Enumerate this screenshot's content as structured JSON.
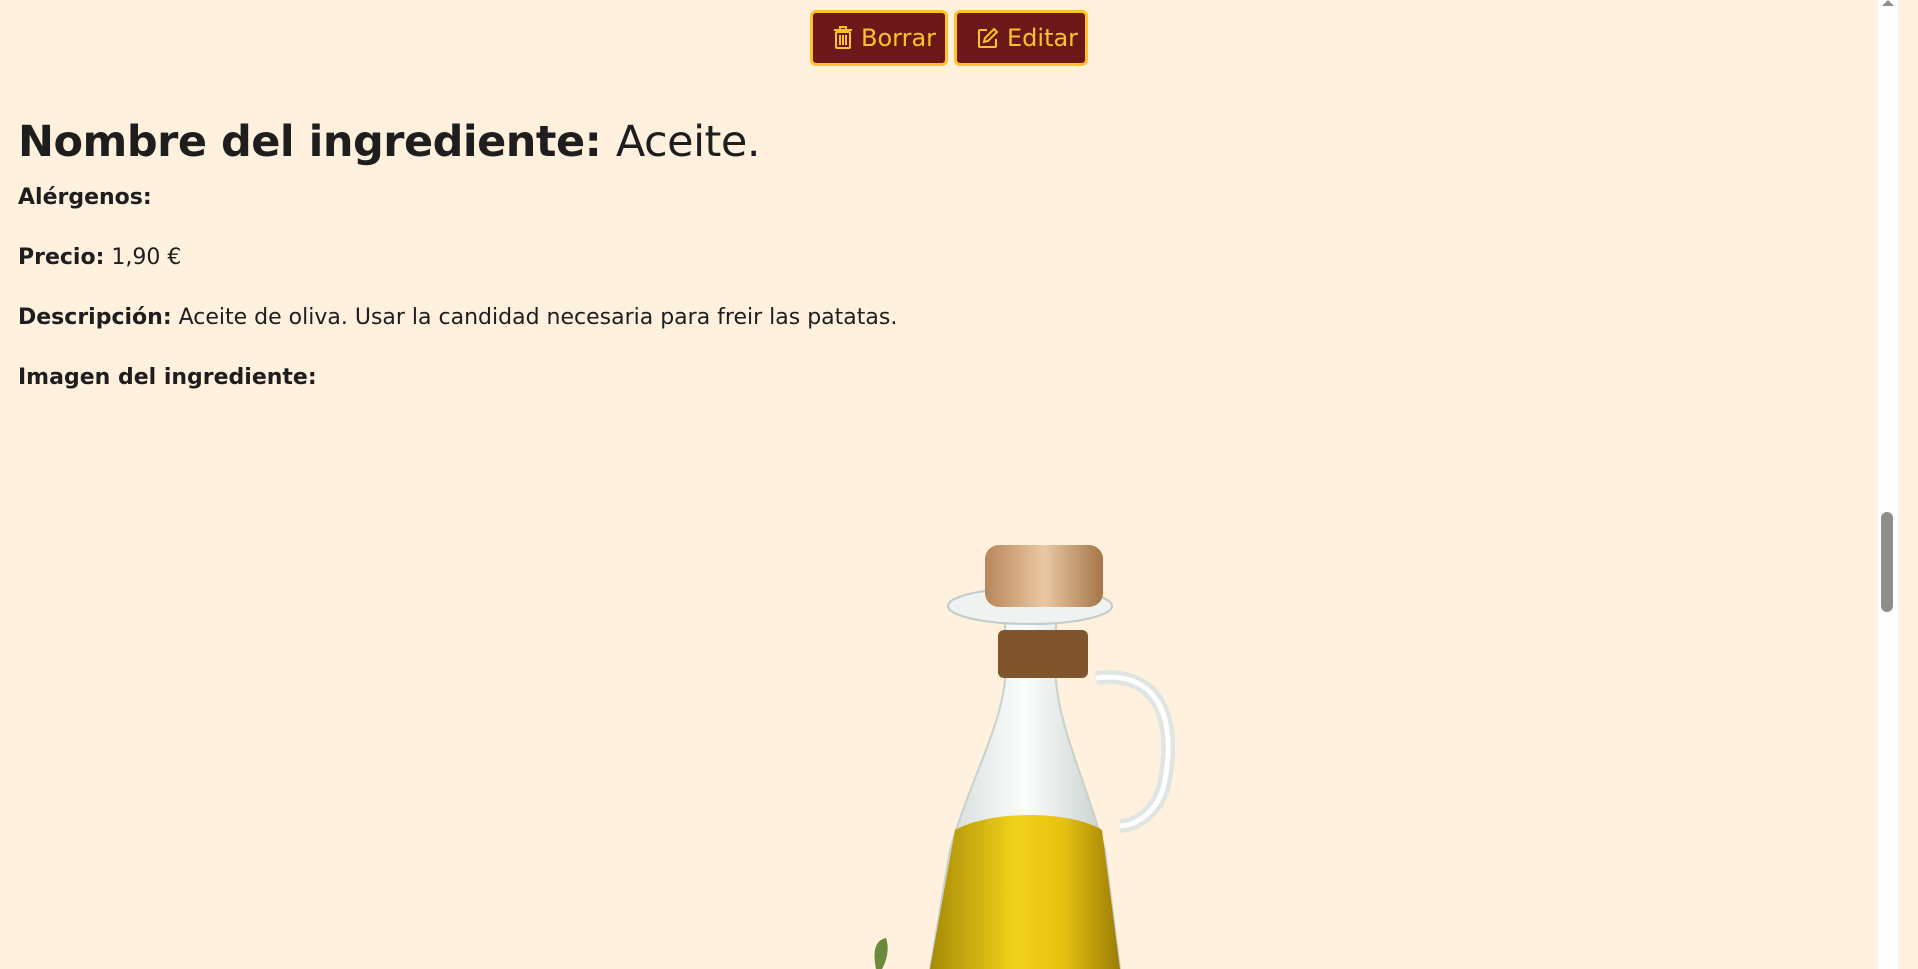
{
  "actions": {
    "delete_label": "Borrar",
    "edit_label": "Editar",
    "delete_icon": "trash-icon",
    "edit_icon": "edit-icon"
  },
  "ingredient": {
    "name_label": "Nombre del ingrediente:",
    "name_value": "Aceite.",
    "allergens_label": "Alérgenos:",
    "allergens_value": "",
    "price_label": "Precio:",
    "price_value": "1,90 €",
    "description_label": "Descripción:",
    "description_value": "Aceite de oliva. Usar la candidad necesaria para freir las patatas.",
    "image_label": "Imagen del ingrediente:"
  },
  "colors": {
    "background": "#fff1de",
    "button_bg": "#6d1818",
    "button_accent": "#ffc129",
    "text": "#1e1e1e"
  }
}
